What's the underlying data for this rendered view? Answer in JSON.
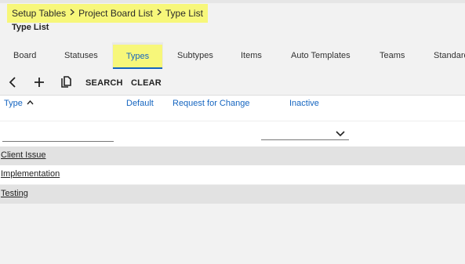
{
  "breadcrumb": {
    "items": [
      "Setup Tables",
      "Project Board List",
      "Type List"
    ],
    "separator": ">"
  },
  "page": {
    "title": "Type List"
  },
  "tabs": [
    {
      "label": "Board"
    },
    {
      "label": "Statuses"
    },
    {
      "label": "Types",
      "active": true
    },
    {
      "label": "Subtypes"
    },
    {
      "label": "Items"
    },
    {
      "label": "Auto Templates"
    },
    {
      "label": "Teams"
    },
    {
      "label": "Standard"
    }
  ],
  "toolbar": {
    "search_label": "SEARCH",
    "clear_label": "CLEAR"
  },
  "table": {
    "columns": [
      "Type",
      "Default",
      "Request for Change",
      "Inactive"
    ],
    "rows": [
      "Client Issue",
      "Implementation",
      "Testing"
    ]
  },
  "colors": {
    "highlight": "#f7f77a",
    "link_blue": "#1565c0",
    "row_shade": "#e2e2e2"
  }
}
